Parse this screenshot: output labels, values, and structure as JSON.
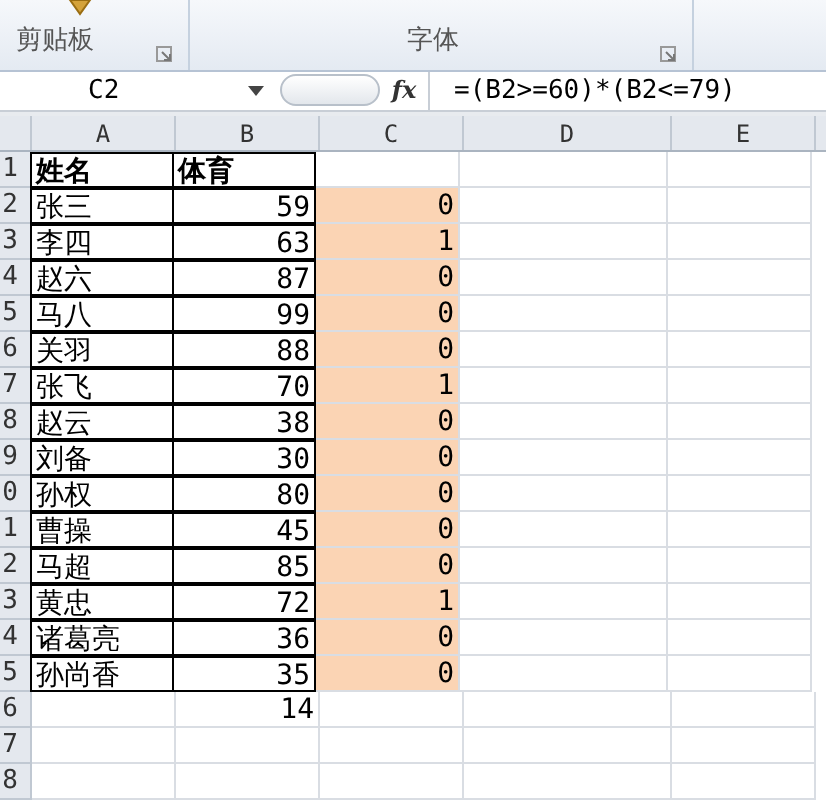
{
  "ribbon": {
    "groups": [
      {
        "label": "剪贴板"
      },
      {
        "label": "字体"
      }
    ]
  },
  "formula_bar": {
    "name_box": "C2",
    "fx": "fx",
    "formula": "=(B2>=60)*(B2<=79)"
  },
  "columns": [
    "A",
    "B",
    "C",
    "D",
    "E"
  ],
  "rows": [
    {
      "header": "1",
      "kind": "heading",
      "cells": [
        "姓名",
        "体育",
        ""
      ],
      "bordered": true,
      "highlighted": false
    },
    {
      "header": "2",
      "kind": "data",
      "cells": [
        "张三",
        "59",
        "0"
      ],
      "bordered": true,
      "highlighted": true
    },
    {
      "header": "3",
      "kind": "data",
      "cells": [
        "李四",
        "63",
        "1"
      ],
      "bordered": true,
      "highlighted": true
    },
    {
      "header": "4",
      "kind": "data",
      "cells": [
        "赵六",
        "87",
        "0"
      ],
      "bordered": true,
      "highlighted": true
    },
    {
      "header": "5",
      "kind": "data",
      "cells": [
        "马八",
        "99",
        "0"
      ],
      "bordered": true,
      "highlighted": true
    },
    {
      "header": "6",
      "kind": "data",
      "cells": [
        "关羽",
        "88",
        "0"
      ],
      "bordered": true,
      "highlighted": true
    },
    {
      "header": "7",
      "kind": "data",
      "cells": [
        "张飞",
        "70",
        "1"
      ],
      "bordered": true,
      "highlighted": true
    },
    {
      "header": "8",
      "kind": "data",
      "cells": [
        "赵云",
        "38",
        "0"
      ],
      "bordered": true,
      "highlighted": true
    },
    {
      "header": "9",
      "kind": "data",
      "cells": [
        "刘备",
        "30",
        "0"
      ],
      "bordered": true,
      "highlighted": true
    },
    {
      "header": "0",
      "kind": "data",
      "cells": [
        "孙权",
        "80",
        "0"
      ],
      "bordered": true,
      "highlighted": true
    },
    {
      "header": "1",
      "kind": "data",
      "cells": [
        "曹操",
        "45",
        "0"
      ],
      "bordered": true,
      "highlighted": true
    },
    {
      "header": "2",
      "kind": "data",
      "cells": [
        "马超",
        "85",
        "0"
      ],
      "bordered": true,
      "highlighted": true
    },
    {
      "header": "3",
      "kind": "data",
      "cells": [
        "黄忠",
        "72",
        "1"
      ],
      "bordered": true,
      "highlighted": true
    },
    {
      "header": "4",
      "kind": "data",
      "cells": [
        "诸葛亮",
        "36",
        "0"
      ],
      "bordered": true,
      "highlighted": true
    },
    {
      "header": "5",
      "kind": "data",
      "cells": [
        "孙尚香",
        "35",
        "0"
      ],
      "bordered": true,
      "highlighted": true
    },
    {
      "header": "6",
      "kind": "data",
      "cells": [
        "",
        "14",
        ""
      ],
      "bordered": false,
      "highlighted": false
    },
    {
      "header": "7",
      "kind": "data",
      "cells": [
        "",
        "",
        ""
      ],
      "bordered": false,
      "highlighted": false
    },
    {
      "header": "8",
      "kind": "data",
      "cells": [
        "",
        "",
        ""
      ],
      "bordered": false,
      "highlighted": false
    }
  ]
}
